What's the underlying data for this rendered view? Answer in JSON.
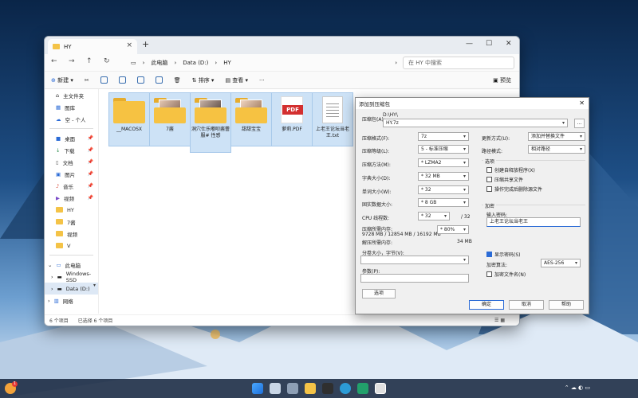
{
  "explorer": {
    "tab_title": "HY",
    "address": {
      "crumbs": [
        "此电脑",
        "Data (D:)",
        "HY"
      ],
      "search_placeholder": "在 HY 中搜索"
    },
    "toolbar": {
      "new_label": "新建",
      "sort_label": "排序",
      "view_label": "查看",
      "more_label": "···",
      "preview_label": "预览"
    },
    "sidebar": {
      "items": [
        {
          "label": "主文件夹",
          "icon": "home-icon"
        },
        {
          "label": "图库",
          "icon": "gallery-icon"
        },
        {
          "label": "空 - 个人",
          "icon": "cloud-icon"
        },
        {
          "label": "桌面",
          "icon": "desktop-icon"
        },
        {
          "label": "下载",
          "icon": "download-icon"
        },
        {
          "label": "文档",
          "icon": "document-icon"
        },
        {
          "label": "图片",
          "icon": "picture-icon"
        },
        {
          "label": "音乐",
          "icon": "music-icon"
        },
        {
          "label": "视频",
          "icon": "video-icon"
        },
        {
          "label": "HY",
          "icon": "folder-icon"
        },
        {
          "label": "7酱",
          "icon": "folder-icon"
        },
        {
          "label": "视频",
          "icon": "folder-icon"
        },
        {
          "label": "V",
          "icon": "folder-icon"
        },
        {
          "label": "此电脑",
          "icon": "computer-icon"
        },
        {
          "label": "Windows-SSD",
          "icon": "drive-icon"
        },
        {
          "label": "Data (D:)",
          "icon": "drive-icon"
        },
        {
          "label": "网络",
          "icon": "network-icon"
        }
      ]
    },
    "files": [
      {
        "name": "__MACOSX",
        "kind": "folder"
      },
      {
        "name": "7酱",
        "kind": "folder-photo"
      },
      {
        "name": "洞穴仕乐嘟呗酱蕾服# 性感",
        "kind": "folder-photo"
      },
      {
        "name": "甜甜宝宝",
        "kind": "folder-photo"
      },
      {
        "name": "萝莉.PDF",
        "kind": "pdf"
      },
      {
        "name": "上老王论坛当老王.txt",
        "kind": "txt"
      }
    ],
    "status": {
      "count": "6 个项目",
      "selected": "已选择 6 个项目"
    }
  },
  "dialog": {
    "title": "添加到压缩包",
    "archive_label": "压缩包(A):",
    "archive_path": "D:\\HY\\",
    "archive_name": "HY.7z",
    "browse": "...",
    "format_label": "压缩格式(F):",
    "format_value": "7z",
    "level_label": "压缩等级(L):",
    "level_value": "5 - 标准压缩",
    "method_label": "压缩方法(M):",
    "method_value": "* LZMA2",
    "dict_label": "字典大小(D):",
    "dict_value": "* 32 MB",
    "word_label": "单词大小(W):",
    "word_value": "* 32",
    "solid_label": "固实数据大小:",
    "solid_value": "* 8 GB",
    "cpu_label": "CPU 线程数:",
    "cpu_value": "* 32",
    "cpu_total": "/ 32",
    "mem_label": "压缩所需内存:",
    "mem_value": "9728 MB / 12854 MB / 16192 MB",
    "mem_pct": "* 80%",
    "decomp_label": "解压所需内存:",
    "decomp_value": "34 MB",
    "split_label": "分卷大小，字节(V):",
    "params_label": "参数(P):",
    "options_button": "选项",
    "update_label": "更新方式(U):",
    "update_value": "添加并替换文件",
    "pathmode_label": "路径模式:",
    "pathmode_value": "相对路径",
    "options_group": "选项",
    "opt_sfx": "创建自释放程序(X)",
    "opt_shared": "压缩共享文件",
    "opt_delete": "操作完成后删除源文件",
    "encrypt_group": "加密",
    "pwd_label": "输入密码:",
    "pwd_value": "上老王论坛当老王",
    "show_pwd": "显示密码(S)",
    "enc_method_label": "加密算法:",
    "enc_method_value": "AES-256",
    "enc_names": "加密文件名(N)",
    "ok": "确定",
    "cancel": "取消",
    "help": "帮助"
  },
  "taskbar": {
    "time": "",
    "notif_count": "1"
  }
}
